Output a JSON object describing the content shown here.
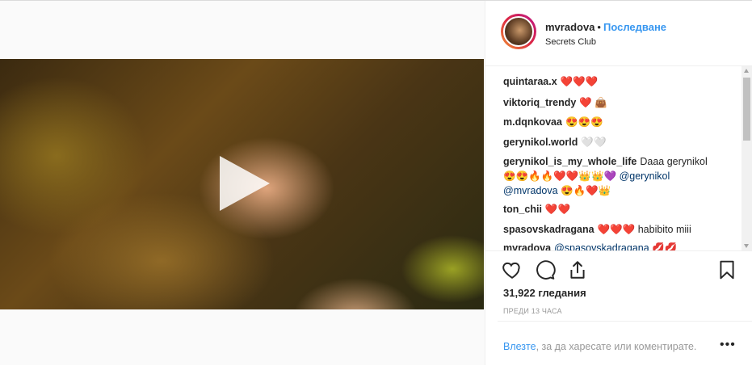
{
  "header": {
    "username": "mvradova",
    "separator": "•",
    "follow_label": "Последване",
    "location": "Secrets Club"
  },
  "comments": [
    {
      "user": "quintaraa.x",
      "text": "❤️❤️❤️"
    },
    {
      "user": "viktoriq_trendy",
      "text": "❤️ 👜"
    },
    {
      "user": "m.dqnkovaa",
      "text": "😍😍😍"
    },
    {
      "user": "gerynikol.world",
      "text": "🤍🤍"
    },
    {
      "user": "gerynikol_is_my_whole_life",
      "text": "Daaa gerynikol",
      "text2": "😍😍🔥🔥❤️❤️👑👑💜",
      "mention1": "@gerynikol",
      "mention2": "@mvradova",
      "text3": "😍🔥❤️👑"
    },
    {
      "user": "ton_chii",
      "text": "❤️❤️"
    },
    {
      "user": "spasovskadragana",
      "text": "❤️❤️❤️ habibito miii"
    },
    {
      "user": "mvradova",
      "mention": "@spasovskadragana",
      "text": "💋💋"
    }
  ],
  "stats": {
    "views": "31,922 гледания",
    "time": "ПРЕДИ 13 ЧАСА"
  },
  "footer": {
    "login_link": "Влезте",
    "login_text": ", за да харесате или коментирате.",
    "more": "•••"
  },
  "icons": {
    "like": "heart-outline-icon",
    "comment": "speech-bubble-icon",
    "share": "share-arrow-icon",
    "save": "bookmark-icon",
    "play": "play-icon"
  }
}
